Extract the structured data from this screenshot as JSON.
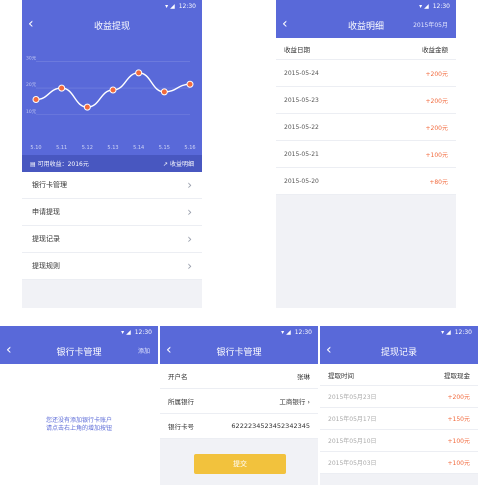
{
  "common": {
    "time": "12:30",
    "back": "‹"
  },
  "screen1": {
    "title": "收益提现",
    "chart_data": {
      "type": "line",
      "categories": [
        "5.10",
        "5.11",
        "5.12",
        "5.13",
        "5.14",
        "5.15",
        "5.16"
      ],
      "values": [
        170,
        200,
        150,
        195,
        240,
        190,
        210
      ],
      "ytick_labels": [
        "30元",
        "20元",
        "10元"
      ],
      "ylim": [
        90,
        300
      ],
      "grid": true,
      "point_color": "#f26a3d",
      "line_color": "#ffffff"
    },
    "summary_left": "可用收益：2016元",
    "summary_right": "收益明细",
    "menu": [
      {
        "label": "银行卡管理"
      },
      {
        "label": "申请提现"
      },
      {
        "label": "提现记录"
      },
      {
        "label": "提现规则"
      }
    ]
  },
  "screen2": {
    "title": "收益明细",
    "month": "2015年05月",
    "head_left": "收益日期",
    "head_right": "收益金额",
    "rows": [
      {
        "date": "2015-05-24",
        "amount": "+200元"
      },
      {
        "date": "2015-05-23",
        "amount": "+200元"
      },
      {
        "date": "2015-05-22",
        "amount": "+200元"
      },
      {
        "date": "2015-05-21",
        "amount": "+100元"
      },
      {
        "date": "2015-05-20",
        "amount": "+80元"
      }
    ]
  },
  "screen3": {
    "title": "银行卡管理",
    "action": "添加",
    "empty_line1": "您还没有添加银行卡账户",
    "empty_line2": "请点击右上角的增加按钮"
  },
  "screen4": {
    "title": "银行卡管理",
    "fields": [
      {
        "label": "开户名",
        "value": "张琳"
      },
      {
        "label": "所属银行",
        "value": "工商银行 ›"
      },
      {
        "label": "银行卡号",
        "value": "6222234523452342345"
      }
    ],
    "submit": "提交"
  },
  "screen5": {
    "title": "提现记录",
    "head_left": "提取时间",
    "head_right": "提取现金",
    "rows": [
      {
        "date": "2015年05月23日",
        "amount": "+200元"
      },
      {
        "date": "2015年05月17日",
        "amount": "+150元"
      },
      {
        "date": "2015年05月10日",
        "amount": "+100元"
      },
      {
        "date": "2015年05月03日",
        "amount": "+100元"
      }
    ]
  },
  "colors": {
    "primary": "#5969d9",
    "accent": "#f26a3d",
    "button": "#f2c23d"
  }
}
